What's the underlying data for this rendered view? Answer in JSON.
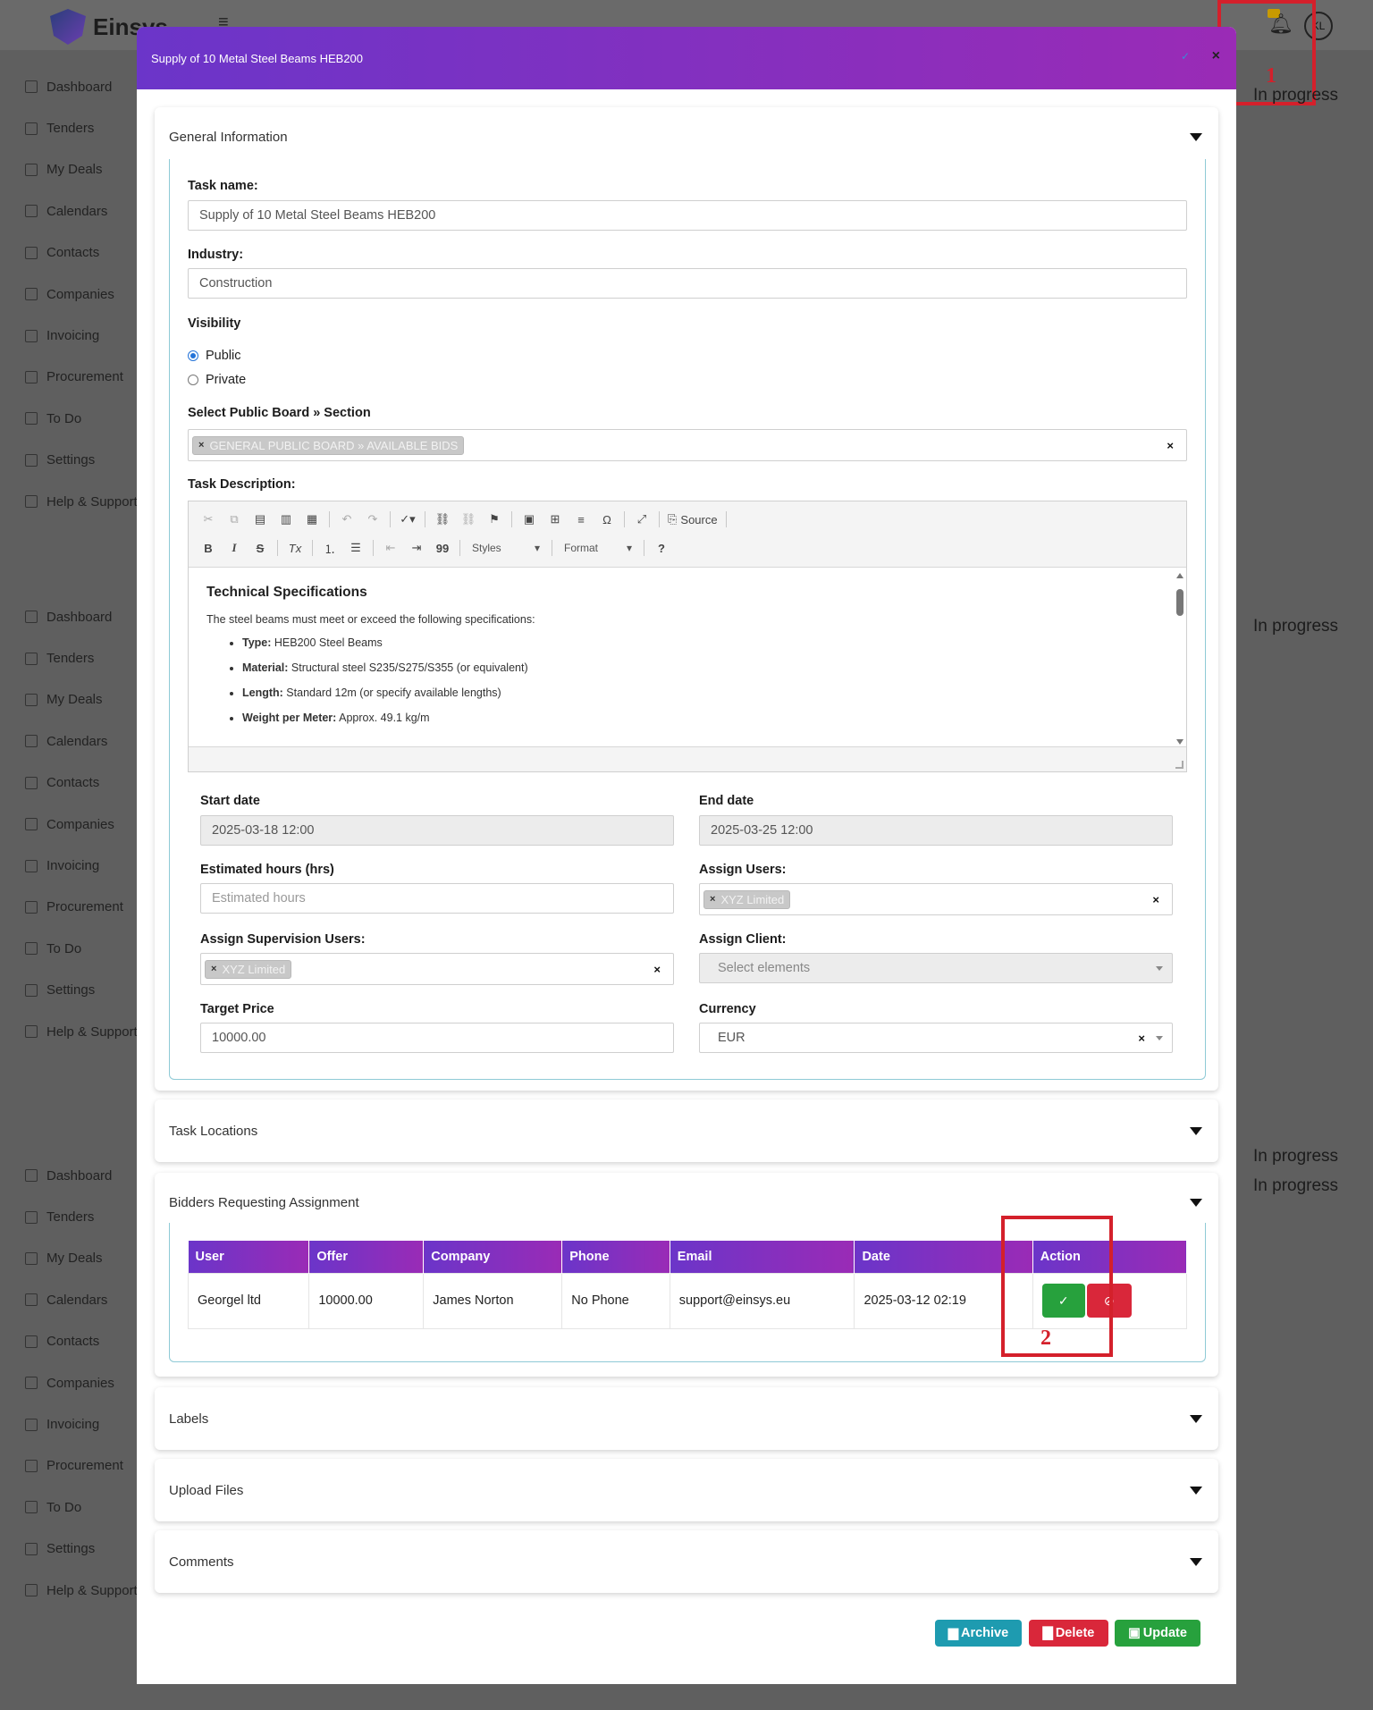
{
  "app": {
    "brand": "Einsys",
    "avatar_initials": "KL",
    "menu_icon": "hamburger-icon",
    "bell_icon": "bell-icon"
  },
  "sidebar": {
    "items": [
      "Dashboard",
      "Tenders",
      "My Deals",
      "Calendars",
      "Contacts",
      "Companies",
      "Invoicing",
      "Procurement",
      "To Do",
      "Settings",
      "Help & Support"
    ]
  },
  "background": {
    "status": "In progress"
  },
  "annotations": {
    "one": "1",
    "two": "2"
  },
  "modal": {
    "title": "Supply of 10 Metal Steel Beams HEB200",
    "close": "×",
    "check": "✓",
    "sections": {
      "general": "General Information",
      "locations": "Task Locations",
      "bidders": "Bidders Requesting Assignment",
      "labels": "Labels",
      "files": "Upload Files",
      "comments": "Comments"
    }
  },
  "form": {
    "task_name_label": "Task name:",
    "task_name_value": "Supply of 10 Metal Steel Beams HEB200",
    "industry_label": "Industry:",
    "industry_value": "Construction",
    "visibility_label": "Visibility",
    "visibility_public": "Public",
    "visibility_private": "Private",
    "board_label": "Select Public Board » Section",
    "board_tag": "GENERAL PUBLIC BOARD » AVAILABLE BIDS",
    "description_label": "Task Description:",
    "start_label": "Start date",
    "start_value": "2025-03-18 12:00",
    "end_label": "End date",
    "end_value": "2025-03-25 12:00",
    "hours_label": "Estimated hours (hrs)",
    "hours_placeholder": "Estimated hours",
    "assign_users_label": "Assign Users:",
    "assign_users_tag": "XYZ Limited",
    "supervision_label": "Assign Supervision Users:",
    "supervision_tag": "XYZ Limited",
    "client_label": "Assign Client:",
    "client_placeholder": "Select elements",
    "target_label": "Target Price",
    "target_value": "10000.00",
    "currency_label": "Currency",
    "currency_value": "EUR",
    "clear": "×"
  },
  "editor": {
    "toolbar": {
      "source": "Source",
      "styles": "Styles",
      "format": "Format",
      "bold": "B",
      "italic": "I",
      "strike": "S",
      "clear_format": "Tx",
      "quote": "99",
      "help": "?",
      "omega": "Ω"
    },
    "heading": "Technical Specifications",
    "intro": "The steel beams must meet or exceed the following specifications:",
    "items": [
      {
        "k": "Type:",
        "v": " HEB200 Steel Beams"
      },
      {
        "k": "Material:",
        "v": " Structural steel S235/S275/S355 (or equivalent)"
      },
      {
        "k": "Length:",
        "v": " Standard 12m (or specify available lengths)"
      },
      {
        "k": "Weight per Meter:",
        "v": " Approx. 49.1 kg/m"
      }
    ]
  },
  "bidders": {
    "headers": [
      "User",
      "Offer",
      "Company",
      "Phone",
      "Email",
      "Date",
      "Action"
    ],
    "rows": [
      {
        "user": "Georgel ltd",
        "offer": "10000.00",
        "company": "James Norton",
        "phone": "No Phone",
        "email": "support@einsys.eu",
        "date": "2025-03-12 02:19"
      }
    ],
    "accept_icon": "check-icon",
    "reject_icon": "block-icon"
  },
  "footer": {
    "archive": "Archive",
    "delete": "Delete",
    "update": "Update"
  },
  "colors": {
    "header_gradient_start": "#6b35c9",
    "header_gradient_end": "#9a2bb6",
    "archive": "#1e9bb0",
    "delete": "#d9273a",
    "update": "#27a13d"
  }
}
